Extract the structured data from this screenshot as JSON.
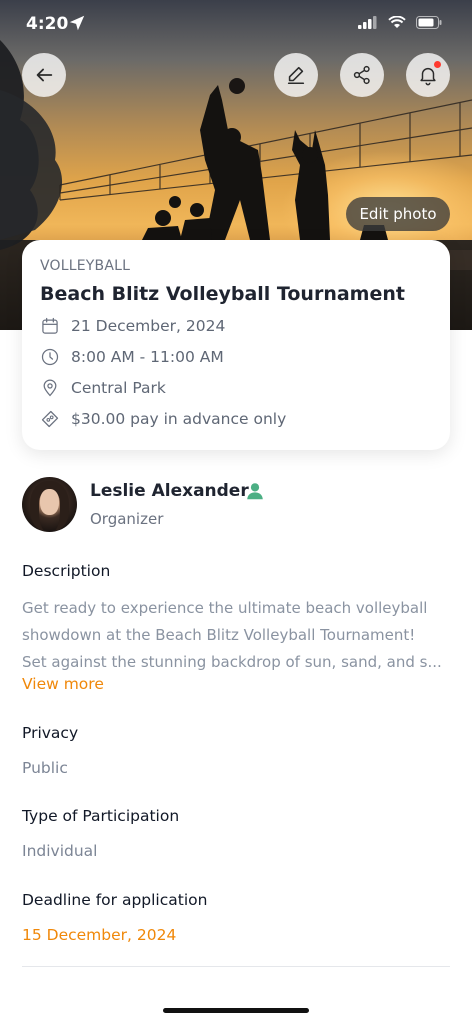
{
  "status_bar": {
    "time": "4:20"
  },
  "hero": {
    "edit_photo_label": "Edit photo"
  },
  "event": {
    "category": "VOLLEYBALL",
    "title": "Beach Blitz Volleyball Tournament",
    "date": "21 December, 2024",
    "time": "8:00 AM - 11:00 AM",
    "location": "Central Park",
    "price": "$30.00 pay in advance only"
  },
  "organizer": {
    "name": "Leslie Alexander",
    "role": "Organizer"
  },
  "description": {
    "label": "Description",
    "lines": [
      "Get ready to experience the ultimate beach volleyball",
      "showdown at the Beach Blitz Volleyball Tournament!",
      "Set against the stunning backdrop of sun, sand, and s..."
    ],
    "view_more": "View more"
  },
  "privacy": {
    "label": "Privacy",
    "value": "Public"
  },
  "participation": {
    "label": "Type of Participation",
    "value": "Individual"
  },
  "deadline": {
    "label": "Deadline for application",
    "value": "15 December, 2024"
  },
  "colors": {
    "accent": "#f0880a",
    "badge_green": "#4caf84",
    "notification": "#ff3b30"
  },
  "icons": {
    "back": "arrow-left-icon",
    "edit": "pencil-icon",
    "share": "share-icon",
    "notify": "bell-icon",
    "date": "calendar-icon",
    "time": "clock-icon",
    "location": "map-pin-icon",
    "price": "ticket-icon",
    "organizer_badge": "user-badge-icon"
  }
}
